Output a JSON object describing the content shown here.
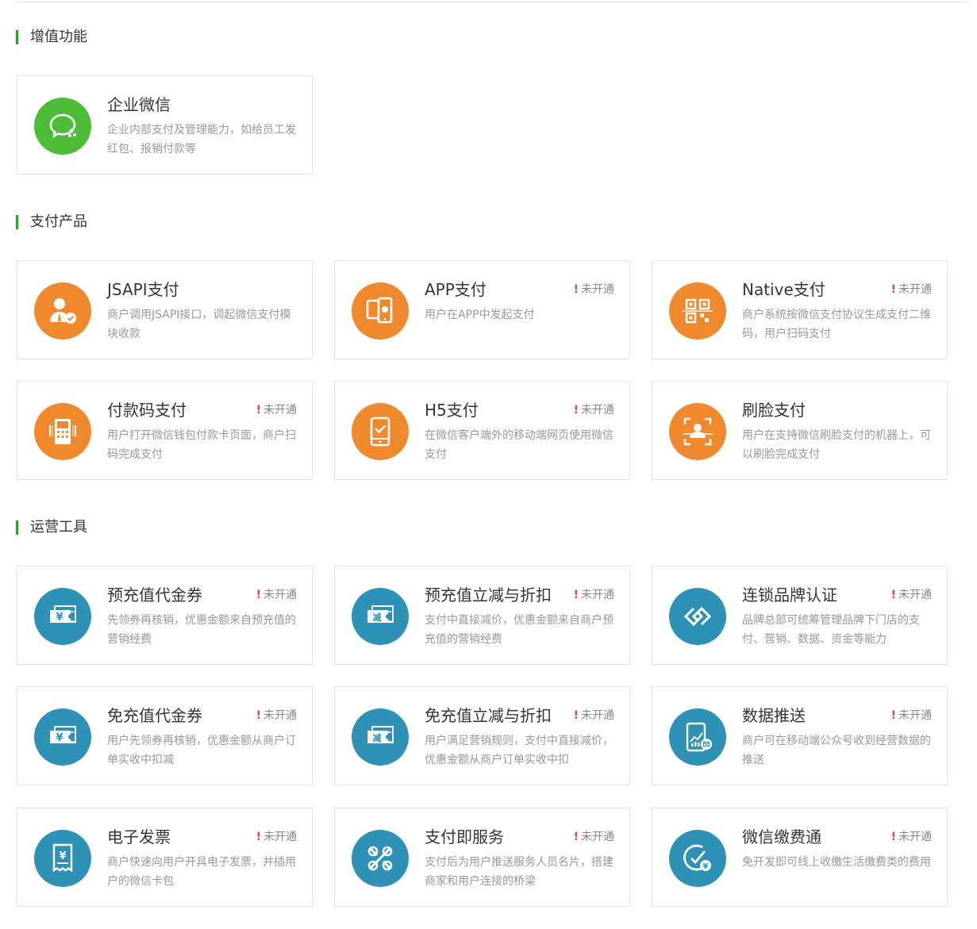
{
  "colors": {
    "accent": "#1aad19",
    "wechat_green": "#4dbd38",
    "orange": "#f0882e",
    "teal": "#2d92b5",
    "alert": "#e64340"
  },
  "sections": {
    "value_added": "增值功能",
    "payment": "支付产品",
    "operations": "运营工具"
  },
  "status_text": "未开通",
  "status_mark": "!",
  "cards": [
    {
      "title": "企业微信",
      "desc": "企业内部支付及管理能力，如给员工发红包、报销付款等",
      "icon": "wecom-chat-icon"
    },
    {
      "title": "JSAPI支付",
      "desc": "商户调用JSAPI接口，调起微信支付模块收款",
      "icon": "user-check-icon"
    },
    {
      "title": "APP支付",
      "desc": "用户在APP中发起支付",
      "icon": "mobile-app-icon"
    },
    {
      "title": "Native支付",
      "desc": "商户系统按微信支付协议生成支付二维码，用户扫码支付",
      "icon": "qr-code-icon"
    },
    {
      "title": "付款码支付",
      "desc": "用户打开微信钱包付款卡页面，商户扫码完成支付",
      "icon": "pos-scan-icon"
    },
    {
      "title": "H5支付",
      "desc": "在微信客户端外的移动端网页使用微信支付",
      "icon": "phone-check-icon"
    },
    {
      "title": "刷脸支付",
      "desc": "用户在支持微信刷脸支付的机器上，可以刷脸完成支付",
      "icon": "face-scan-icon"
    },
    {
      "title": "预充值代金券",
      "desc": "先领券再核销，优惠金额来自预充值的营销经费",
      "icon": "voucher-yuan-icon"
    },
    {
      "title": "预充值立减与折扣",
      "desc": "支付中直接减价，优惠金额来自商户预充值的营销经费",
      "icon": "voucher-discount-icon"
    },
    {
      "title": "连锁品牌认证",
      "desc": "品牌总部可统筹管理品牌下门店的支付、营销、数据、资金等能力",
      "icon": "chain-link-icon"
    },
    {
      "title": "免充值代金券",
      "desc": "用户先领券再核销，优惠金额从商户订单实收中扣减",
      "icon": "voucher-yuan-icon"
    },
    {
      "title": "免充值立减与折扣",
      "desc": "用户满足营销规则，支付中直接减价，优惠金额从商户订单实收中扣",
      "icon": "voucher-discount-icon"
    },
    {
      "title": "数据推送",
      "desc": "商户可在移动端公众号收到经营数据的推送",
      "icon": "data-push-icon"
    },
    {
      "title": "电子发票",
      "desc": "商户快速向用户开具电子发票，并插用户的微信卡包",
      "icon": "invoice-icon"
    },
    {
      "title": "支付即服务",
      "desc": "支付后为用户推送服务人员名片，搭建商家和用户连接的桥梁",
      "icon": "service-link-icon"
    },
    {
      "title": "微信缴费通",
      "desc": "免开发即可线上收缴生活缴费类的费用",
      "icon": "bill-pay-icon"
    }
  ]
}
